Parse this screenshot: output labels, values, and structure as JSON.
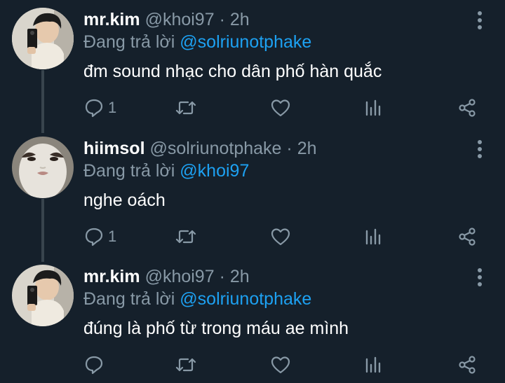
{
  "tweets": [
    {
      "name": "mr.kim",
      "handle": "@khoi97",
      "separator": "·",
      "time": "2h",
      "reply_prefix": "Đang trả lời",
      "reply_to": "@solriunotphake",
      "text": "đm sound nhạc cho dân phố hàn quắc",
      "reply_count": "1",
      "avatar": "selfie-avatar"
    },
    {
      "name": "hiimsol",
      "handle": "@solriunotphake",
      "separator": "·",
      "time": "2h",
      "reply_prefix": "Đang trả lời",
      "reply_to": "@khoi97",
      "text": "nghe oách",
      "reply_count": "1",
      "avatar": "face-mask-avatar"
    },
    {
      "name": "mr.kim",
      "handle": "@khoi97",
      "separator": "·",
      "time": "2h",
      "reply_prefix": "Đang trả lời",
      "reply_to": "@solriunotphake",
      "text": "đúng là phố từ trong máu ae mình",
      "reply_count": "",
      "avatar": "selfie-avatar"
    }
  ],
  "colors": {
    "background": "#15202b",
    "text": "#ffffff",
    "muted": "#8899a6",
    "mention": "#1da1f2",
    "thread_line": "#38444d"
  },
  "icons": [
    "more-vertical-icon",
    "reply-icon",
    "retweet-icon",
    "like-icon",
    "views-icon",
    "share-icon"
  ]
}
